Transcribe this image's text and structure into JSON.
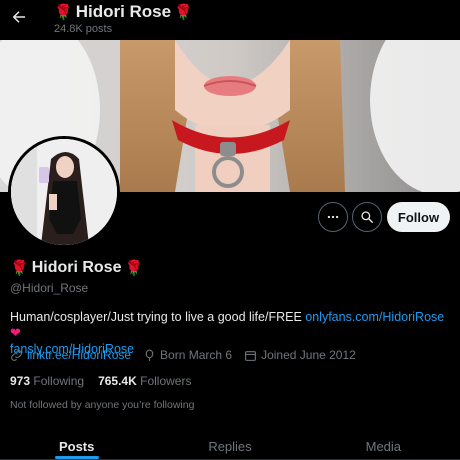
{
  "header": {
    "title": "Hidori Rose",
    "posts_count": "24.8K posts",
    "back_icon": "arrow-left-icon"
  },
  "profile": {
    "display_name": "Hidori Rose",
    "name_emoji": "rose-icon",
    "handle": "@Hidori_Rose",
    "bio": {
      "text": "Human/cosplayer/Just trying to live a good life/FREE ",
      "link1": "onlyfans.com/HidoriRose",
      "heart_icon": "heart-icon",
      "link2": "fansly.com/HidoriRose"
    },
    "meta": {
      "website": "linktr.ee/HidoriRose",
      "birthday": "Born March 6",
      "joined": "Joined June 2012"
    },
    "stats": {
      "following_count": "973",
      "following_label": "Following",
      "followers_count": "765.4K",
      "followers_label": "Followers"
    },
    "not_followed": "Not followed by anyone you’re following"
  },
  "actions": {
    "more_icon": "more-icon",
    "search_icon": "search-icon",
    "follow_label": "Follow"
  },
  "tabs": [
    {
      "label": "Posts",
      "active": true
    },
    {
      "label": "Replies",
      "active": false
    },
    {
      "label": "Media",
      "active": false
    }
  ],
  "colors": {
    "background": "#000000",
    "accent_link": "#1d9bf0",
    "rose": "#d4141e",
    "heart": "#f91880",
    "muted": "#71767b"
  }
}
